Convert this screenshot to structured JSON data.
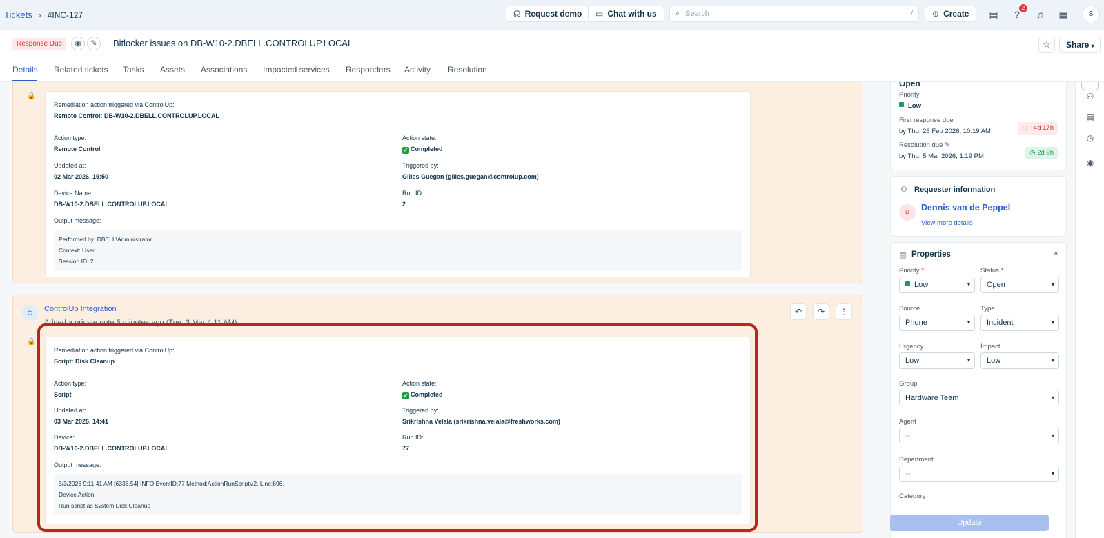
{
  "breadcrumb": {
    "root": "Tickets",
    "separator": "›",
    "current": "#INC-127"
  },
  "topbar": {
    "request_demo": "Request demo",
    "chat": "Chat with us",
    "search_placeholder": "Search",
    "search_shortcut": "/",
    "create": "Create",
    "help_badge": "2",
    "avatar": "S"
  },
  "ticket": {
    "status_badge": "Response Due",
    "title": "Bitlocker issues on DB-W10-2.DBELL.CONTROLUP.LOCAL",
    "share": "Share"
  },
  "tabs": [
    "Details",
    "Related tickets",
    "Tasks",
    "Assets",
    "Associations",
    "Impacted services",
    "Responders",
    "Activity",
    "Resolution"
  ],
  "note1": {
    "heading": "Remediation action triggered via ControlUp:",
    "action_title": "Remote Control: DB-W10-2.DBELL.CONTROLUP.LOCAL",
    "action_type_label": "Action type:",
    "action_type": "Remote Control",
    "action_state_label": "Action state:",
    "action_state": "Completed",
    "updated_label": "Updated at:",
    "updated": "02 Mar 2026, 15:50",
    "triggered_label": "Triggered by:",
    "triggered": "Gilles Guegan (gilles.guegan@controlup.com)",
    "device_label": "Device Name:",
    "device": "DB-W10-2.DBELL.CONTROLUP.LOCAL",
    "run_label": "Run ID:",
    "run": "2",
    "output_label": "Output message:",
    "output": [
      "Performed by: DBELL\\Administrator",
      "Context: User",
      "Session ID: 2"
    ]
  },
  "note2": {
    "avatar": "C",
    "author": "ControlUp Integration",
    "meta": "Added a private note 5 minutes ago (Tue, 3 Mar 4:11 AM).",
    "heading": "Remediation action triggered via ControlUp:",
    "action_title": "Script: Disk Cleanup",
    "action_type_label": "Action type:",
    "action_type": "Script",
    "action_state_label": "Action state:",
    "action_state": "Completed",
    "updated_label": "Updated at:",
    "updated": "03 Mar 2026, 14:41",
    "triggered_label": "Triggered by:",
    "triggered": "Srikrishna Velala (srikrishna.velala@freshworks.com)",
    "device_label": "Device:",
    "device": "DB-W10-2.DBELL.CONTROLUP.LOCAL",
    "run_label": "Run ID:",
    "run": "77",
    "output_label": "Output message:",
    "output": [
      "3/3/2026 9:11:41 AM [6336.54] INFO EventID:77 Method:ActionRunScriptV2, Line:696,",
      "Device Action",
      "Run script as System:Disk Cleanup"
    ]
  },
  "status_card": {
    "status": "Open",
    "priority_label": "Priority",
    "priority": "Low",
    "first_response_label": "First response due",
    "first_response": "by Thu, 26 Feb 2026, 10:19 AM",
    "first_response_pill": "- 4d 17h",
    "resolution_label": "Resolution due",
    "resolution": "by Thu, 5 Mar 2026, 1:19 PM",
    "resolution_pill": "2d 9h"
  },
  "requester": {
    "heading": "Requester information",
    "avatar": "D",
    "name": "Dennis van de Peppel",
    "link": "View more details"
  },
  "properties": {
    "heading": "Properties",
    "priority_label": "Priority",
    "priority": "Low",
    "status_label": "Status",
    "status": "Open",
    "source_label": "Source",
    "source": "Phone",
    "type_label": "Type",
    "type": "Incident",
    "urgency_label": "Urgency",
    "urgency": "Low",
    "impact_label": "Impact",
    "impact": "Low",
    "group_label": "Group",
    "group": "Hardware Team",
    "agent_label": "Agent",
    "agent": "--",
    "department_label": "Department",
    "department": "--",
    "category_label": "Category",
    "update": "Update"
  },
  "colors": {
    "accent": "#2c5cc5",
    "note_bg": "#fdeee2",
    "highlight": "#b02a20",
    "success": "#1ba23e"
  }
}
